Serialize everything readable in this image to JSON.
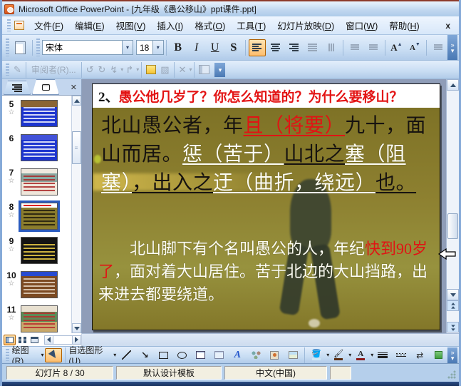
{
  "window": {
    "title": "Microsoft Office PowerPoint - [九年级《愚公移山》ppt课件.ppt]"
  },
  "menu_bar": {
    "items": [
      {
        "label": "文件(F)"
      },
      {
        "label": "编辑(E)"
      },
      {
        "label": "视图(V)"
      },
      {
        "label": "插入(I)"
      },
      {
        "label": "格式(O)"
      },
      {
        "label": "工具(T)"
      },
      {
        "label": "幻灯片放映(D)"
      },
      {
        "label": "窗口(W)"
      },
      {
        "label": "帮助(H)"
      }
    ],
    "close_label": "x"
  },
  "format_toolbar": {
    "font_name": "宋体",
    "font_size": "18",
    "bold": "B",
    "italic": "I",
    "underline": "U",
    "shadow": "S",
    "grow_font": "A",
    "shrink_font": "A"
  },
  "review_toolbar": {
    "reviewers_label": "审阅者(R)..."
  },
  "sidebar": {
    "slides": [
      {
        "number": "5",
        "selected": false
      },
      {
        "number": "6",
        "selected": false
      },
      {
        "number": "7",
        "selected": false
      },
      {
        "number": "8",
        "selected": true
      },
      {
        "number": "9",
        "selected": false
      },
      {
        "number": "10",
        "selected": false
      },
      {
        "number": "11",
        "selected": false
      }
    ],
    "animation_star": "☆"
  },
  "slide": {
    "title_segments": [
      {
        "t": "2、",
        "c": "tk"
      },
      {
        "t": "愚公他几岁了？你怎么知道的？为什么要移山？",
        "c": "tr"
      }
    ],
    "para1_segments": [
      {
        "t": "北山愚公者，年",
        "c": "k"
      },
      {
        "t": "且（将要）",
        "c": "r u"
      },
      {
        "t": "九十，面山而居。",
        "c": "k"
      },
      {
        "t": "惩（苦于）",
        "c": "w u"
      },
      {
        "t": "山北之",
        "c": "k u"
      },
      {
        "t": "塞（阻塞）",
        "c": "w u"
      },
      {
        "t": "，出入之",
        "c": "k u"
      },
      {
        "t": "迂（曲折，绕远）",
        "c": "w u"
      },
      {
        "t": "也。",
        "c": "k u"
      }
    ],
    "para2_segments": [
      {
        "t": "北山脚下有个名叫愚公的人，年纪",
        "c": "w2"
      },
      {
        "t": "快到90岁了",
        "c": "r2"
      },
      {
        "t": "，面对着大山居住。苦于北边的大山挡路，出来进去都要绕道。",
        "c": "w2"
      }
    ]
  },
  "drawing_toolbar": {
    "draw_label": "绘图(R)",
    "autoshapes_label": "自选图形(U)",
    "wordart_letter": "A",
    "font_color_letter": "A"
  },
  "status_bar": {
    "slide_info": "幻灯片 8 / 30",
    "design_template": "默认设计模板",
    "language": "中文(中国)"
  },
  "icons": {
    "dropdown": "▾",
    "chevron_more": "»",
    "left_arrow": "◄",
    "right_arrow": "►",
    "up_arrow": "▲",
    "down_arrow": "▼",
    "close_x": "✕",
    "line_diag": "",
    "shape_arrow": "↘"
  },
  "colors": {
    "accent_red": "#e01414",
    "slide_bg_olive": "#8a7d2a",
    "annotation_white": "#fdfdf4",
    "selection_orange": "#fdbe6e"
  }
}
